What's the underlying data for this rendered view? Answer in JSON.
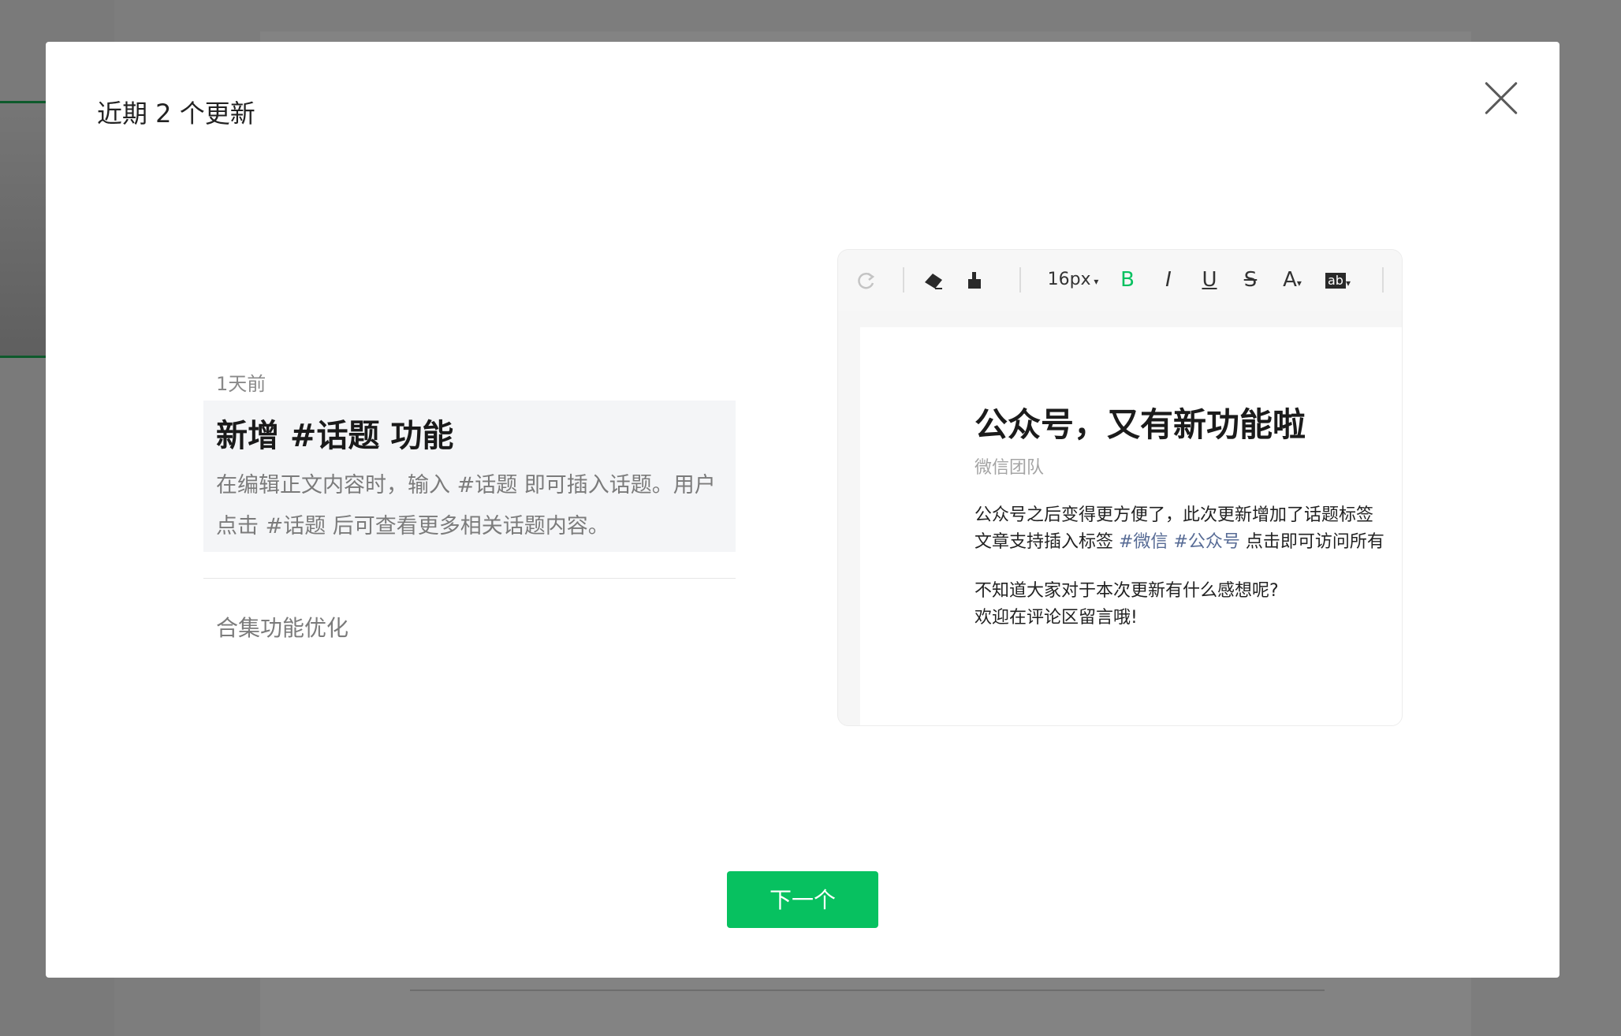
{
  "modal": {
    "title": "近期 2 个更新",
    "close_icon": "close-icon",
    "next_button_label": "下一个"
  },
  "updates": [
    {
      "time": "1天前",
      "title": "新增 #话题 功能",
      "description": "在编辑正文内容时，输入 #话题 即可插入话题。用户点击 #话题 后可查看更多相关话题内容。"
    },
    {
      "title": "合集功能优化"
    }
  ],
  "preview": {
    "toolbar": {
      "redo_icon": "redo-icon",
      "eraser_icon": "eraser-icon",
      "format_painter_icon": "format-painter-icon",
      "font_size": "16px",
      "bold": "B",
      "italic": "I",
      "underline": "U",
      "strikethrough": "S",
      "font_color": "A",
      "background_color": "ab"
    },
    "article": {
      "title": "公众号，又有新功能啦",
      "author": "微信团队",
      "line1": "公众号之后变得更方便了，此次更新增加了话题标签",
      "line2_before": "文章支持插入标签 ",
      "tag1": "#微信",
      "tag2": "#公众号",
      "line2_after": " 点击即可访问所有",
      "line3": "不知道大家对于本次更新有什么感想呢?",
      "line4": "欢迎在评论区留言哦!"
    }
  },
  "colors": {
    "accent": "#07c160",
    "tag": "#576b95"
  }
}
